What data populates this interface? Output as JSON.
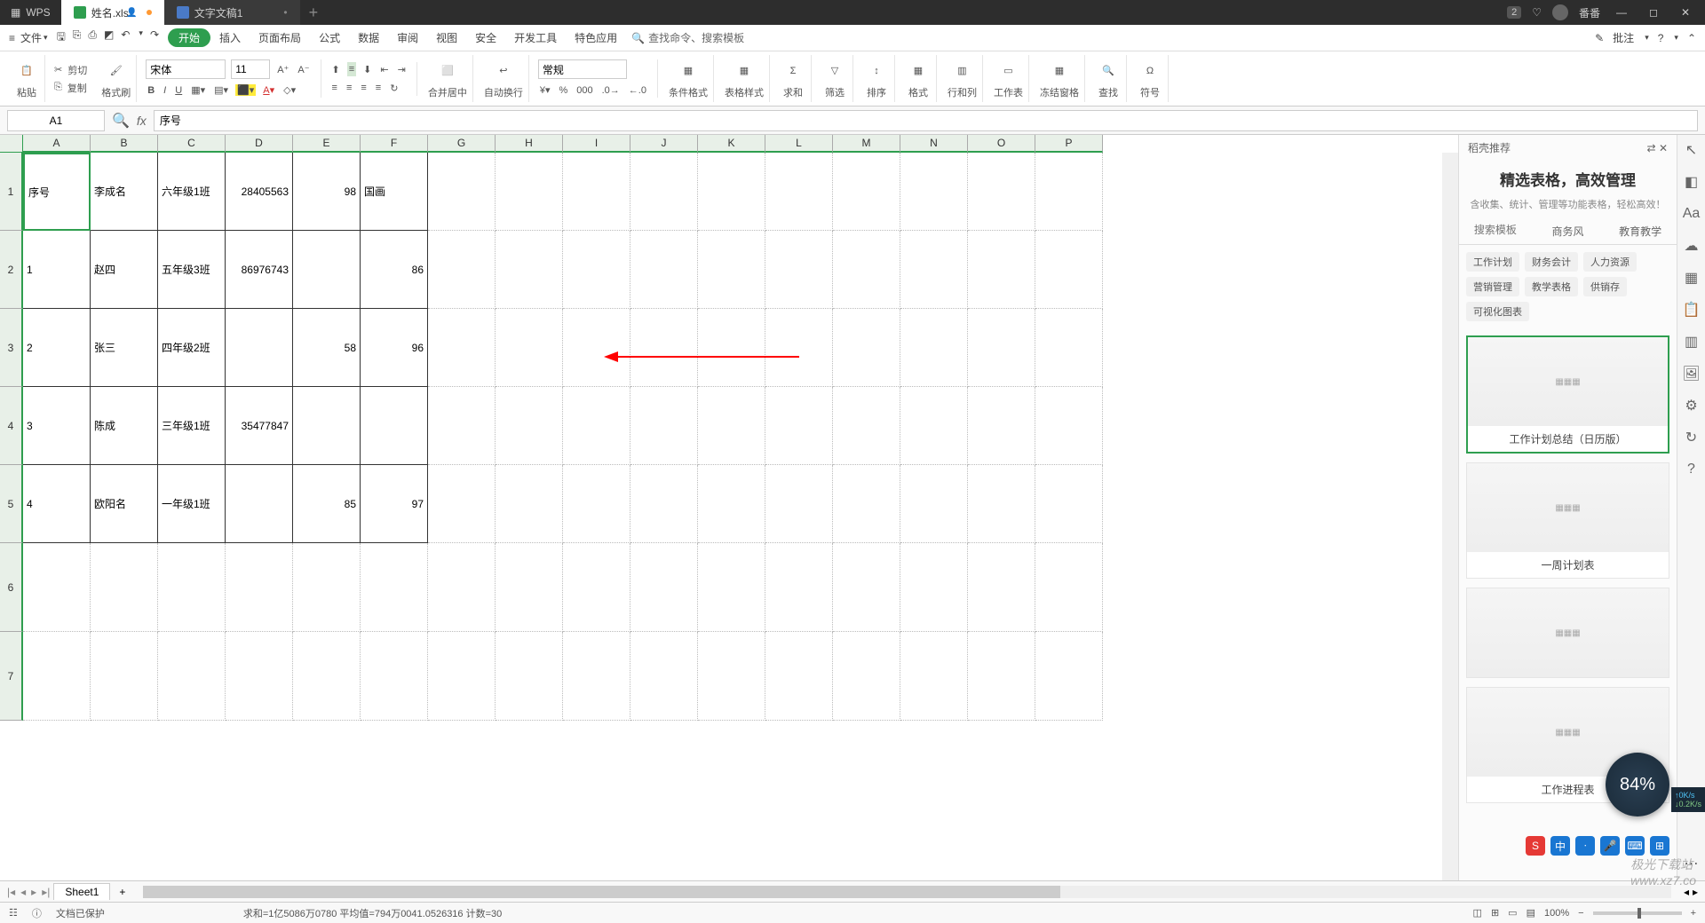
{
  "titleBar": {
    "appName": "WPS",
    "tabs": [
      {
        "label": "姓名.xlsx",
        "type": "xlsx",
        "active": true,
        "badge": "👤",
        "unsaved": true
      },
      {
        "label": "文字文稿1",
        "type": "docx",
        "active": false
      }
    ],
    "notificationCount": "2",
    "userName": "番番"
  },
  "menu": {
    "fileLabel": "文件",
    "items": [
      "开始",
      "插入",
      "页面布局",
      "公式",
      "数据",
      "审阅",
      "视图",
      "安全",
      "开发工具",
      "特色应用"
    ],
    "activeIndex": 0,
    "searchPlaceholder": "查找命令、搜索模板",
    "rightLabel": "批注"
  },
  "ribbon": {
    "paste": "粘贴",
    "cut": "剪切",
    "copy": "复制",
    "formatPainter": "格式刷",
    "fontName": "宋体",
    "fontSize": "11",
    "mergeCenter": "合并居中",
    "autoWrap": "自动换行",
    "numberFormat": "常规",
    "condFormat": "条件格式",
    "tableStyle": "表格样式",
    "sum": "求和",
    "filter": "筛选",
    "sort": "排序",
    "format": "格式",
    "rowCol": "行和列",
    "worksheet": "工作表",
    "freezePane": "冻结窗格",
    "find": "查找",
    "symbol": "符号"
  },
  "formulaBar": {
    "cellRef": "A1",
    "fx": "fx",
    "value": "序号"
  },
  "grid": {
    "columns": [
      "A",
      "B",
      "C",
      "D",
      "E",
      "F",
      "G",
      "H",
      "I",
      "J",
      "K",
      "L",
      "M",
      "N",
      "O",
      "P"
    ],
    "colWidthsData": [
      76,
      76,
      76,
      76,
      76,
      76
    ],
    "colWidthRest": 76,
    "rowHeightData": 88,
    "rows": [
      {
        "n": "1",
        "cells": [
          "序号",
          "李成名",
          "六年级1班",
          "28405563",
          "98",
          "国画"
        ]
      },
      {
        "n": "2",
        "cells": [
          "1",
          "赵四",
          "五年级3班",
          "86976743",
          "",
          "86"
        ]
      },
      {
        "n": "3",
        "cells": [
          "2",
          "张三",
          "四年级2班",
          "",
          "58",
          "96"
        ]
      },
      {
        "n": "4",
        "cells": [
          "3",
          "陈成",
          "三年级1班",
          "35477847",
          "",
          ""
        ]
      },
      {
        "n": "5",
        "cells": [
          "4",
          "欧阳名",
          "一年级1班",
          "",
          "85",
          "97"
        ]
      }
    ],
    "emptyRows": [
      "6",
      "7"
    ]
  },
  "rightPanel": {
    "header": "稻壳推荐",
    "title": "精选表格，高效管理",
    "subtitle": "含收集、统计、管理等功能表格，轻松高效！",
    "searchPlaceholder": "搜索模板",
    "tabs": [
      "商务风",
      "教育教学"
    ],
    "tags": [
      "工作计划",
      "财务会计",
      "人力资源",
      "营销管理",
      "教学表格",
      "供销存",
      "可视化图表"
    ],
    "templates": [
      "工作计划总结（日历版）",
      "一周计划表",
      "",
      "工作进程表"
    ]
  },
  "sheetTabs": {
    "active": "Sheet1"
  },
  "statusBar": {
    "protected": "文档已保护",
    "stats": "求和=1亿5086万0780   平均值=794万0041.0526316   计数=30",
    "zoom": "100%"
  },
  "floating": {
    "percent": "84%",
    "up": "0K/s",
    "down": "0.2K/s"
  },
  "watermark": "极光下载站\nwww.xz7.co"
}
